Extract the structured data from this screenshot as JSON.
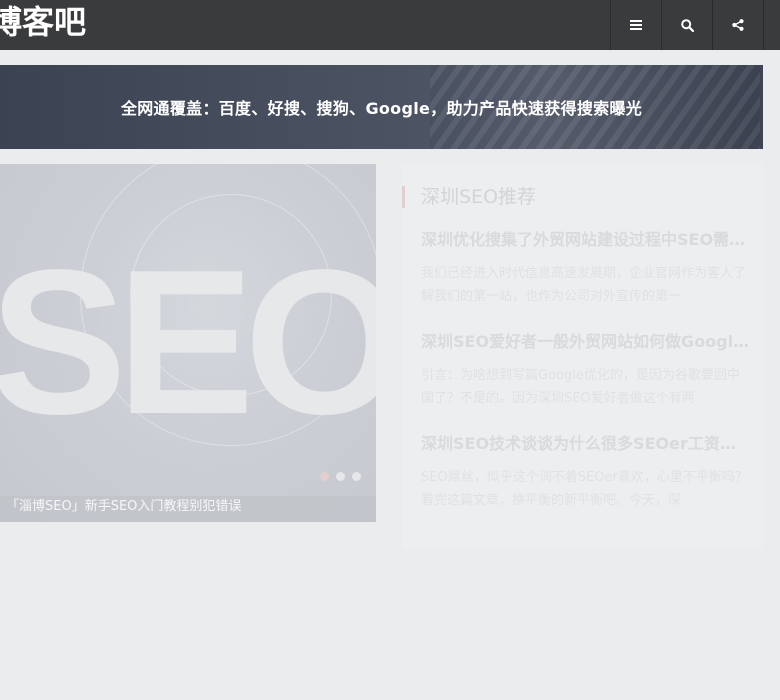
{
  "header": {
    "logo": "博客吧",
    "buttons": [
      {
        "icon": "menu-icon"
      },
      {
        "icon": "search-icon"
      },
      {
        "icon": "share-icon"
      }
    ]
  },
  "banner": {
    "text": "全网通覆盖：百度、好搜、搜狗、Google，助力产品快速获得搜索曝光"
  },
  "slider": {
    "image_text": "SEO",
    "caption": "「淄博SEO」新手SEO入门教程别犯错误",
    "dots": 3,
    "active_dot": 0
  },
  "panel": {
    "title": "深圳SEO推荐",
    "posts": [
      {
        "title": "深圳优化搜集了外贸网站建设过程中SEO需要注意的事项",
        "excerpt": "我们已经进入时代信息高速发展期，企业官网作为客人了解我们的第一站，也作为公司对外宣传的第一"
      },
      {
        "title": "深圳SEO爱好者一般外贸网站如何做Google优化",
        "excerpt": "引言：为啥想到写篇Google优化的，是因为谷歌要回中国了？不是的。因为深圳SEO爱好者做这个有两"
      },
      {
        "title": "深圳SEO技术谈谈为什么很多SEOer工资那么低",
        "excerpt": "SEO屌丝，似乎这个词不着SEOer喜欢，心里不平衡吗？看完这篇文章，换平衡的新平衡吧。今天，深"
      }
    ]
  },
  "colors": {
    "header_bg": "#3a3b3d",
    "page_bg": "#ebecee",
    "accent": "#e2cdd1"
  }
}
